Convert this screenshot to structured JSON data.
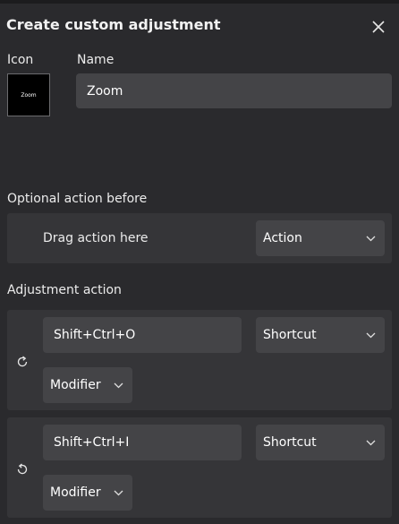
{
  "dialog": {
    "title": "Create custom adjustment"
  },
  "icon_section": {
    "label": "Icon",
    "preview_text": "Zoom"
  },
  "name_section": {
    "label": "Name",
    "value": "Zoom"
  },
  "optional_action": {
    "heading": "Optional action before",
    "drag_text": "Drag action here",
    "type_label": "Action"
  },
  "adjustment": {
    "heading": "Adjustment action",
    "rows": [
      {
        "direction_icon": "rotate-clockwise-icon",
        "shortcut": "Shift+Ctrl+O",
        "type_label": "Shortcut",
        "modifier_label": "Modifier"
      },
      {
        "direction_icon": "rotate-counterclockwise-icon",
        "shortcut": "Shift+Ctrl+I",
        "type_label": "Shortcut",
        "modifier_label": "Modifier"
      }
    ]
  },
  "colors": {
    "panel_bg": "#2a2a2d",
    "card_bg": "#353538",
    "input_bg": "#444447",
    "text": "#ffffff"
  }
}
